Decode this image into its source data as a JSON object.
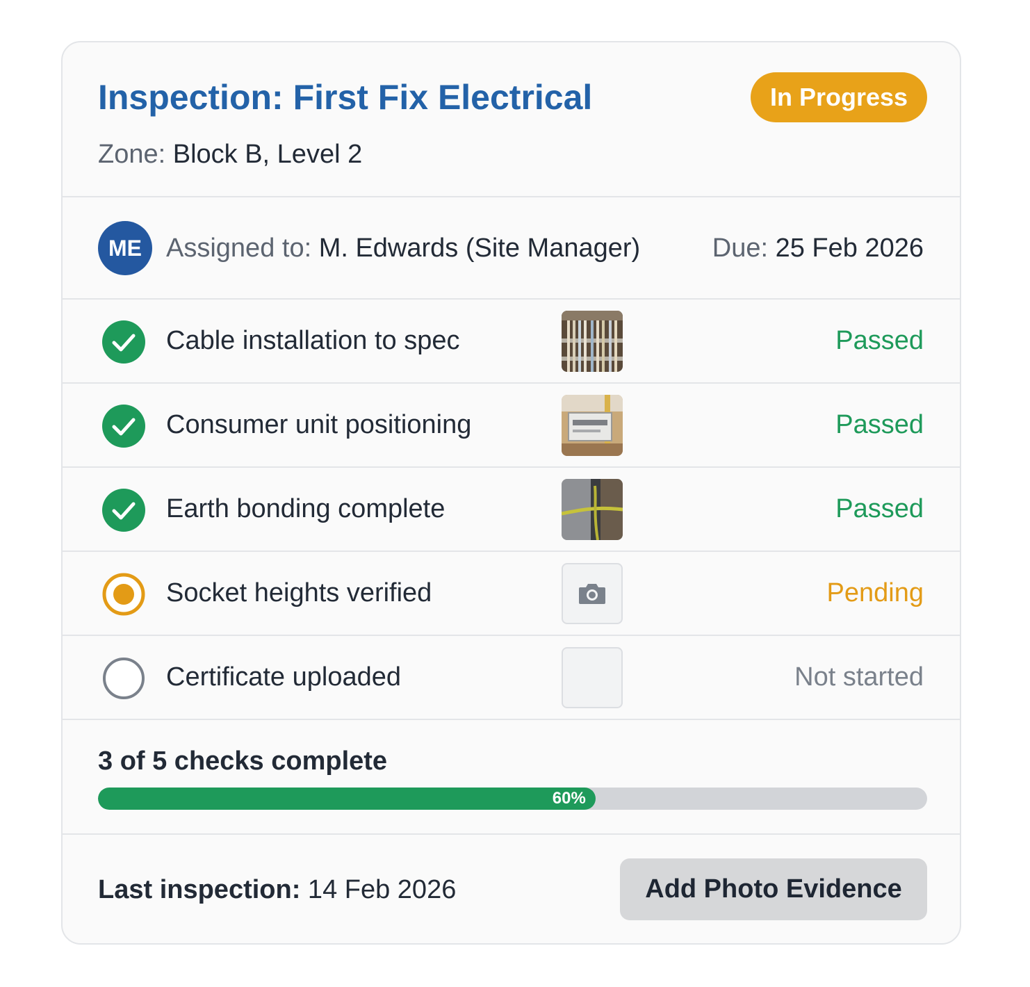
{
  "inspection": {
    "title": "Inspection: First Fix Electrical",
    "status_badge": "In Progress",
    "zone_label": "Zone: ",
    "zone_value": "Block B, Level 2"
  },
  "assignment": {
    "avatar_initials": "ME",
    "assigned_label": "Assigned to: ",
    "assigned_value": "M. Edwards (Site Manager)",
    "due_label": "Due: ",
    "due_value": "25 Feb 2026"
  },
  "checks": [
    {
      "label": "Cable installation to spec",
      "status": "Passed",
      "state": "passed",
      "photo": "cable-tray-photo"
    },
    {
      "label": "Consumer unit positioning",
      "status": "Passed",
      "state": "passed",
      "photo": "consumer-unit-photo"
    },
    {
      "label": "Earth bonding complete",
      "status": "Passed",
      "state": "passed",
      "photo": "earth-bonding-photo"
    },
    {
      "label": "Socket heights verified",
      "status": "Pending",
      "state": "pending",
      "photo": "camera-icon"
    },
    {
      "label": "Certificate uploaded",
      "status": "Not started",
      "state": "not-started",
      "photo": "empty"
    }
  ],
  "progress": {
    "label": "3 of 5 checks complete",
    "percent_label": "60%",
    "fraction": 0.6
  },
  "footer": {
    "last_inspection_label": "Last inspection:",
    "last_inspection_value": " 14 Feb 2026",
    "add_photo_button": "Add Photo Evidence"
  },
  "colors": {
    "title": "#2362a8",
    "badge": "#e8a219",
    "passed": "#1e9a5a",
    "pending": "#e39b16",
    "not_started": "#7a818b"
  }
}
